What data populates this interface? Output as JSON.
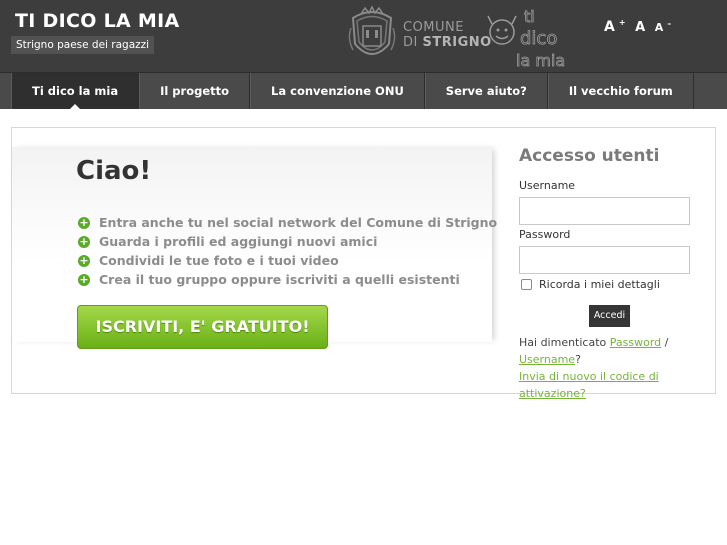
{
  "header": {
    "title": "TI DICO LA MIA",
    "tagline": "Strigno paese dei ragazzi",
    "comune_line1": "COMUNE",
    "comune_line2_prefix": "DI",
    "comune_line2_name": "STRIGNO",
    "logo_text": [
      "ti",
      "dico",
      "la mia"
    ],
    "font_tools": {
      "increase": "A",
      "normal": "A",
      "decrease": "A",
      "plus": "+",
      "minus": "–"
    }
  },
  "nav": {
    "items": [
      {
        "label": "Ti dico la mia",
        "active": true
      },
      {
        "label": "Il progetto"
      },
      {
        "label": "La convenzione ONU"
      },
      {
        "label": "Serve aiuto?"
      },
      {
        "label": "Il vecchio forum"
      }
    ]
  },
  "welcome": {
    "heading": "Ciao!",
    "features": [
      "Entra anche tu nel social network del Comune di Strigno",
      "Guarda i profili ed aggiungi nuovi amici",
      "Condividi le tue foto e i tuoi video",
      "Crea il tuo gruppo oppure iscriviti a quelli esistenti"
    ],
    "signup_label": "ISCRIVITI, E' GRATUITO!"
  },
  "login": {
    "title": "Accesso utenti",
    "username_label": "Username",
    "username_value": "",
    "password_label": "Password",
    "password_value": "",
    "remember_label": "Ricorda i miei dettagli",
    "submit_label": "Accedi",
    "forgot_prefix": "Hai dimenticato",
    "forgot_password": "Password",
    "forgot_sep": " / ",
    "forgot_username": "Username",
    "forgot_suffix": "?",
    "resend_label": "Invia di nuovo il codice di attivazione?"
  },
  "colors": {
    "header_bg": "#3d3d3d",
    "nav_bg": "#4a4a4a",
    "accent_green": "#76b33a",
    "button_green": "#6ab017"
  }
}
